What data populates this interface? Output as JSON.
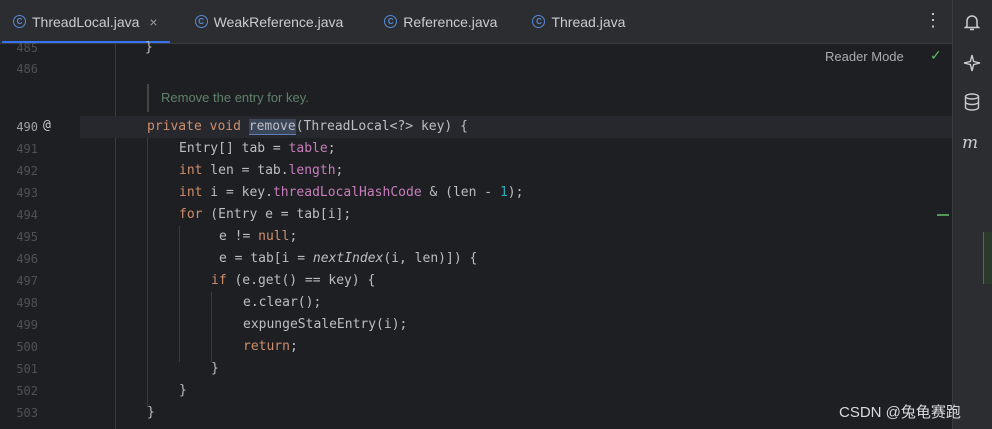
{
  "tabs": [
    {
      "icon": "class-icon",
      "label": "ThreadLocal.java",
      "active": true,
      "closable": true
    },
    {
      "icon": "class-icon",
      "label": "WeakReference.java",
      "active": false
    },
    {
      "icon": "class-icon",
      "label": "Reference.java",
      "active": false
    },
    {
      "icon": "class-icon",
      "label": "Thread.java",
      "active": false
    }
  ],
  "tab_close_glyph": "×",
  "more_glyph": "⋮",
  "reader_mode": "Reader Mode",
  "doc_comment": "Remove the entry for key.",
  "line_numbers": [
    "485",
    "486",
    "490",
    "491",
    "492",
    "493",
    "494",
    "495",
    "496",
    "497",
    "498",
    "499",
    "500",
    "501",
    "502",
    "503"
  ],
  "code": {
    "l485": "}",
    "l490_a": "private void ",
    "l490_b": "remove",
    "l490_c": "(ThreadLocal<?> key) {",
    "l491_a": "Entry[] tab = ",
    "l491_b": "table",
    "l491_c": ";",
    "l492_a": "int",
    "l492_b": " len = tab.",
    "l492_c": "length",
    "l492_d": ";",
    "l493_a": "int",
    "l493_b": " i = key.",
    "l493_c": "threadLocalHashCode",
    "l493_d": " & (len - ",
    "l493_e": "1",
    "l493_f": ");",
    "l494_a": "for",
    "l494_b": " (Entry e = tab[i];",
    "l495_a": "e != ",
    "l495_b": "null",
    "l495_c": ";",
    "l496_a": "e = tab[i = ",
    "l496_b": "nextIndex",
    "l496_c": "(i, len)]) {",
    "l497_a": "if",
    "l497_b": " (e.get() == key) {",
    "l498": "e.clear();",
    "l499": "expungeStaleEntry(i);",
    "l500": "return",
    "l500_b": ";",
    "l501": "}",
    "l502": "}",
    "l503": "}"
  },
  "watermark": "CSDN @兔龟赛跑",
  "colors": {
    "keyword": "#cf8e6d",
    "field": "#c77dbb",
    "number": "#2aacb8",
    "doc": "#5f826b",
    "accent": "#3574f0"
  }
}
